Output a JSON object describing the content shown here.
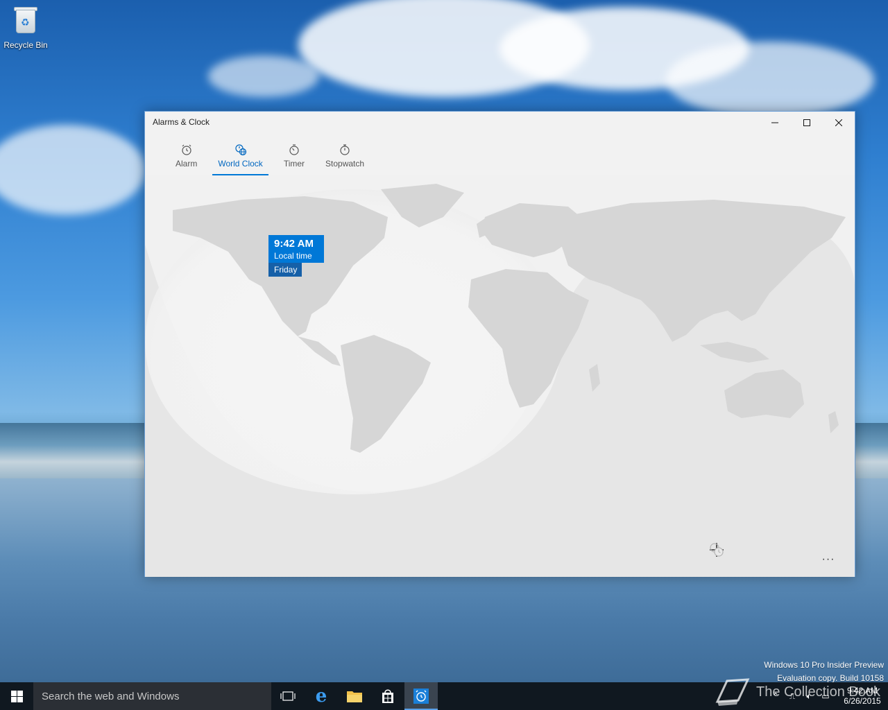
{
  "desktop": {
    "icons": [
      {
        "label": "Recycle Bin",
        "icon": "recycle-bin-icon"
      }
    ],
    "watermark": {
      "line1": "Windows 10 Pro Insider Preview",
      "line2": "Evaluation copy. Build 10158"
    },
    "brand_text": "The Collection Book"
  },
  "window": {
    "title": "Alarms & Clock",
    "controls": {
      "minimize": "minimize-icon",
      "maximize": "maximize-icon",
      "close": "close-icon"
    },
    "tabs": [
      {
        "label": "Alarm",
        "icon": "alarm-icon",
        "active": false
      },
      {
        "label": "World Clock",
        "icon": "world-clock-icon",
        "active": true
      },
      {
        "label": "Timer",
        "icon": "timer-icon",
        "active": false
      },
      {
        "label": "Stopwatch",
        "icon": "stopwatch-icon",
        "active": false
      }
    ],
    "world_clock": {
      "pin": {
        "time": "9:42 AM",
        "label": "Local time",
        "day": "Friday"
      }
    },
    "bottom_bar": {
      "add": "add-icon",
      "compare": "compare-icon",
      "more": "more-icon",
      "more_text": "···"
    },
    "accent_color": "#0078d7"
  },
  "taskbar": {
    "search_placeholder": "Search the web and Windows",
    "apps": [
      "task-view-icon",
      "edge-icon",
      "file-explorer-icon",
      "store-icon",
      "alarms-clock-icon"
    ],
    "clock": {
      "time": "9:42 AM",
      "date": "6/26/2015"
    }
  }
}
